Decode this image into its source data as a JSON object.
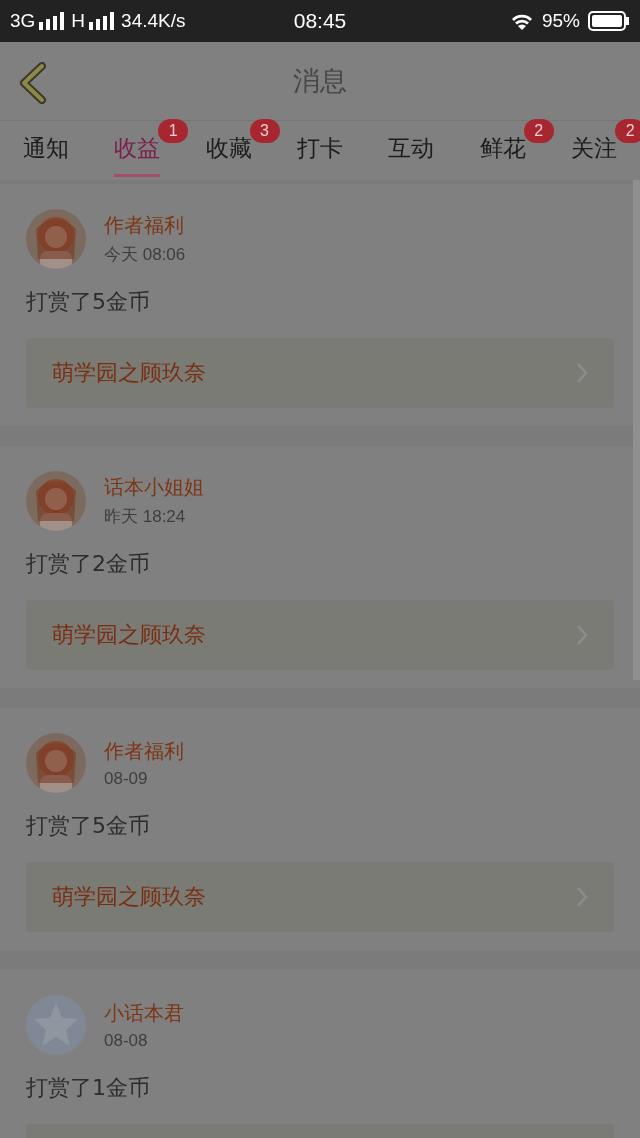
{
  "status_bar": {
    "network": "3G",
    "network_2": "H",
    "speed": "34.4K/s",
    "time": "08:45",
    "battery": "95%"
  },
  "header": {
    "title": "消息"
  },
  "tabs": [
    {
      "label": "通知",
      "selected": false
    },
    {
      "label": "收益",
      "selected": true,
      "badge": "1"
    },
    {
      "label": "收藏",
      "selected": false,
      "badge": "3"
    },
    {
      "label": "打卡",
      "selected": false
    },
    {
      "label": "互动",
      "selected": false
    },
    {
      "label": "鲜花",
      "selected": false,
      "badge": "2"
    },
    {
      "label": "关注",
      "selected": false,
      "badge": "2"
    }
  ],
  "messages": [
    {
      "name": "作者福利",
      "time": "今天 08:06",
      "text": "打赏了5金币",
      "link": "萌学园之顾玖奈"
    },
    {
      "name": "话本小姐姐",
      "time": "昨天 18:24",
      "text": "打赏了2金币",
      "link": "萌学园之顾玖奈"
    },
    {
      "name": "作者福利",
      "time": "08-09",
      "text": "打赏了5金币",
      "link": "萌学园之顾玖奈"
    },
    {
      "avatar": {
        "kind": "default"
      },
      "name": "小话本君",
      "time": "08-08",
      "text": "打赏了1金币"
    }
  ]
}
